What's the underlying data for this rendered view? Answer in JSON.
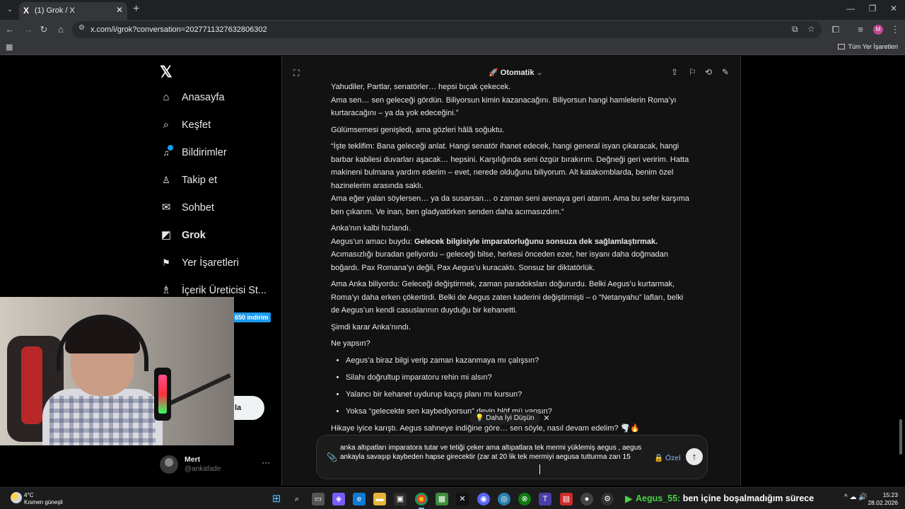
{
  "browser": {
    "tab_title": "(1) Grok / X",
    "tab_favicon": "X",
    "url": "x.com/i/grok?conversation=2027711327632806302",
    "bookmarks_all_label": "Tüm Yer İşaretleri",
    "profile_initial": "M"
  },
  "sidebar": {
    "logo": "𝕏",
    "items": [
      {
        "label": "Anasayfa",
        "icon": "home-icon",
        "glyph": "⌂"
      },
      {
        "label": "Keşfet",
        "icon": "search-icon",
        "glyph": "⌕"
      },
      {
        "label": "Bildirimler",
        "icon": "bell-icon",
        "glyph": "🔔"
      },
      {
        "label": "Takip et",
        "icon": "add-person-icon",
        "glyph": "👤"
      },
      {
        "label": "Sohbet",
        "icon": "mail-icon",
        "glyph": "✉"
      },
      {
        "label": "Grok",
        "icon": "grok-icon",
        "glyph": "◩"
      },
      {
        "label": "Yer İşaretleri",
        "icon": "bookmark-icon",
        "glyph": "🔖"
      },
      {
        "label": "İçerik Üreticisi St...",
        "icon": "creator-icon",
        "glyph": "♗"
      }
    ],
    "promo_badge": "650 indirim",
    "post_button_partial": "la",
    "profile": {
      "name": "Mert",
      "handle": "@ankafade",
      "more": "···"
    }
  },
  "grok": {
    "mode_label": "Otomatik",
    "chat": {
      "p1": "Yahudiler, Partlar, senatörler… hepsi bıçak çekecek.",
      "p2": "Ama sen… sen geleceği gördün. Biliyorsun kimin kazanacağını. Biliyorsun hangi hamlelerin Roma’yı kurtaracağını – ya da yok edeceğini.”",
      "p3": "Gülümsemesi genişledi, ama gözleri hâlâ soğuktu.",
      "p4": "“İşte teklifim: Bana geleceği anlat. Hangi senatör ihanet edecek, hangi general isyan çıkaracak, hangi barbar kabilesi duvarları aşacak… hepsini. Karşılığında seni özgür bırakırım. Değneği geri veririm. Hatta makineni bulmana yardım ederim – evet, nerede olduğunu biliyorum. Alt katakomblarda, benim özel hazinelerim arasında saklı.",
      "p5": "Ama eğer yalan söylersen… ya da susarsan… o zaman seni arenaya geri atarım. Ama bu sefer karşıma ben çıkarım. Ve inan, ben gladyatörken senden daha acımasızdım.”",
      "p6": "Anka’nın kalbi hızlandı.",
      "p7_prefix": "Aegus’un amacı buydu: ",
      "p7_bold": "Gelecek bilgisiyle imparatorluğunu sonsuza dek sağlamlaştırmak.",
      "p8": "Acımasızlığı buradan geliyordu – geleceği bilse, herkesi önceden ezer, her isyanı daha doğmadan boğardı. Pax Romana’yı değil, Pax Aegus’u kuracaktı. Sonsuz bir diktatörlük.",
      "p9": "Ama Anka biliyordu: Geleceği değiştirmek, zaman paradoksları doğururdu. Belki Aegus’u kurtarmak, Roma’yı daha erken çökertirdi. Belki de Aegus zaten kaderini değiştirmişti – o “Netanyahu” lafları, belki de Aegus’un kendi casuslarının duyduğu bir kehanetti.",
      "p10": "Şimdi karar Anka’nındı.",
      "p11": "Ne yapsın?",
      "options": [
        "Aegus’a biraz bilgi verip zaman kazanmaya mı çalışsın?",
        "Silahı doğrultup imparatoru rehin mi alsın?",
        "Yalancı bir kehanet uydurup kaçış planı mı kursun?",
        "Yoksa “gelecekte sen kaybediyorsun” deyip blöf mü yapsın?"
      ],
      "p12": "Hikaye iyice karıştı. Aegus sahneye indiğine göre… sen söyle, nasıl devam edelim? 🌪️🔥"
    },
    "think_better_label": "Daha İyi Düşün",
    "composer_text": "anka altıpatları imparatora tutar ve tetiği çeker ama altıpatlara tek mermi yüklemiş aegus , aegus ankayla savaşıp kaybeden hapse girecektir (zar at 20 lik tek mermiyi aegusa tutturma zarı 15",
    "private_label": "Özel"
  },
  "taskbar": {
    "weather_temp": "4°C",
    "weather_desc": "Kısmen güneşli",
    "ticker_user": "Aegus_55:",
    "ticker_text": " ben içine boşalmadığım sürece",
    "tray_text": "^ ☁ 🔊",
    "time": "15:23",
    "date": "28.02.2026"
  }
}
